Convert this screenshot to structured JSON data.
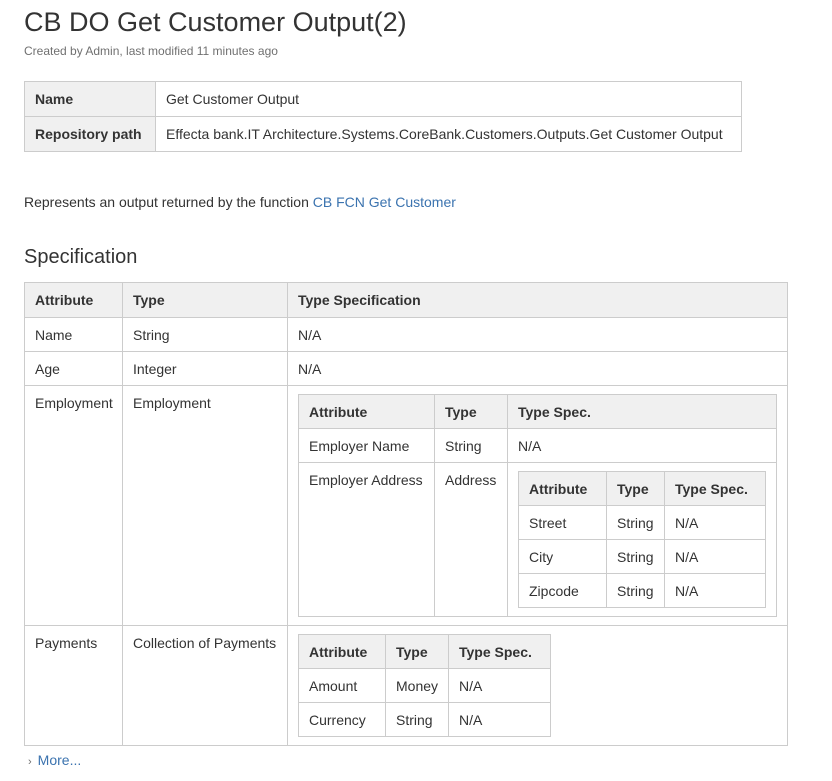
{
  "page": {
    "title": "CB DO Get Customer Output(2)",
    "byline": "Created by Admin, last modified 11 minutes ago"
  },
  "properties": {
    "rows": [
      {
        "key": "Name",
        "value": "Get Customer Output"
      },
      {
        "key": "Repository path",
        "value": "Effecta bank.IT Architecture.Systems.CoreBank.Customers.Outputs.Get Customer Output"
      }
    ]
  },
  "description": {
    "text": "Represents an output returned by the function ",
    "link": "CB FCN Get Customer"
  },
  "specification": {
    "heading": "Specification",
    "headers": [
      "Attribute",
      "Type",
      "Type Specification"
    ],
    "rows": [
      {
        "attribute": "Name",
        "type": "String",
        "spec": "N/A"
      },
      {
        "attribute": "Age",
        "type": "Integer",
        "spec": "N/A"
      },
      {
        "attribute": "Employment",
        "type": "Employment",
        "nested": {
          "headers": [
            "Attribute",
            "Type",
            "Type Spec."
          ],
          "rows": [
            {
              "attribute": "Employer Name",
              "type": "String",
              "spec": "N/A"
            },
            {
              "attribute": "Employer Address",
              "type": "Address",
              "nested": {
                "headers": [
                  "Attribute",
                  "Type",
                  "Type Spec."
                ],
                "rows": [
                  {
                    "attribute": "Street",
                    "type": "String",
                    "spec": "N/A"
                  },
                  {
                    "attribute": "City",
                    "type": "String",
                    "spec": "N/A"
                  },
                  {
                    "attribute": "Zipcode",
                    "type": "String",
                    "spec": "N/A"
                  }
                ]
              }
            }
          ]
        }
      },
      {
        "attribute": "Payments",
        "type": "Collection of Payments",
        "nested": {
          "headers": [
            "Attribute",
            "Type",
            "Type Spec."
          ],
          "rows": [
            {
              "attribute": "Amount",
              "type": "Money",
              "spec": "N/A"
            },
            {
              "attribute": "Currency",
              "type": "String",
              "spec": "N/A"
            }
          ]
        }
      }
    ]
  },
  "more": {
    "label": "More..."
  },
  "colors": {
    "link": "#3b73af",
    "header_bg": "#f0f0f0",
    "border": "#cccccc",
    "text": "#333333"
  }
}
